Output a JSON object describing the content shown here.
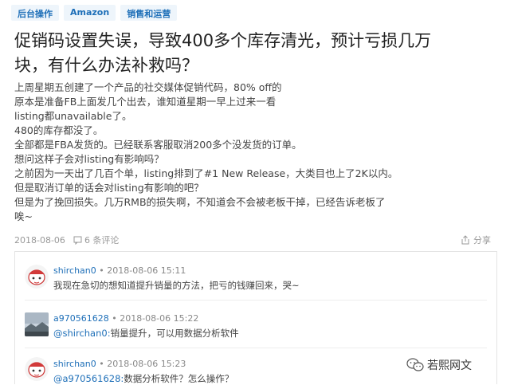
{
  "nav": {
    "tags": [
      "后台操作",
      "Amazon",
      "销售和运营"
    ]
  },
  "post": {
    "title_line1": "促销码设置失误，导致400多个库存清光，预计亏损几万",
    "title_line2": "块，有什么办法补救吗？",
    "body": [
      "上周星期五创建了一个产品的社交媒体促销代码，80% off的",
      "原本是准备FB上面发几个出去，谁知道星期一早上过来一看",
      "listing都unavailable了。",
      "480的库存都没了。",
      "全部都是FBA发货的。已经联系客服取消200多个没发货的订单。",
      "想问这样子会对listing有影响吗？",
      "之前因为一天出了几百个单，listing排到了#1 New Release，大类目也上了2K以内。",
      "但是取消订单的话会对listing有影响的吧？",
      "但是为了挽回损失。几万RMB的损失啊，不知道会不会被老板干掉，已经告诉老板了",
      "唉~"
    ],
    "date": "2018-08-06",
    "comment_count_label": "6 条评论",
    "share_label": "分享"
  },
  "comments": [
    {
      "user": "shirchan0",
      "time": "• 2018-08-06 15:11",
      "mention": "",
      "text": "我现在急切的想知道提升销量的方法，把亏的钱赚回来，哭~",
      "avatar": "cartoon-avatar"
    },
    {
      "user": "a970561628",
      "time": "• 2018-08-06 15:22",
      "mention": "@shirchan0:",
      "text": "销量提升，可以用数据分析软件",
      "avatar": "landscape-avatar"
    },
    {
      "user": "shirchan0",
      "time": "• 2018-08-06 15:23",
      "mention": "@a970561628:",
      "text": "数据分析软件？怎么操作？",
      "avatar": "cartoon-avatar"
    }
  ],
  "watermark": {
    "text": "若熙网文"
  },
  "colors": {
    "accent": "#1e6fb8",
    "tag_bg": "#eef5fb",
    "meta": "#999999"
  }
}
